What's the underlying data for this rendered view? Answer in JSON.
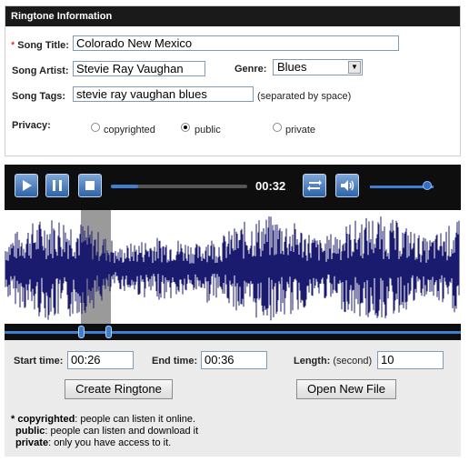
{
  "info": {
    "header": "Ringtone Information",
    "required_mark": "*",
    "song_title_label": "Song Title:",
    "song_title_value": "Colorado New Mexico",
    "song_artist_label": "Song Artist:",
    "song_artist_value": "Stevie Ray Vaughan",
    "genre_label": "Genre:",
    "genre_value": "Blues",
    "song_tags_label": "Song Tags:",
    "song_tags_value": "stevie ray vaughan blues",
    "song_tags_hint": "(separated by space)",
    "privacy_label": "Privacy:",
    "privacy_options": [
      "copyrighted",
      "public",
      "private"
    ],
    "privacy_selected": "public"
  },
  "player": {
    "time": "00:32",
    "progress_fraction": 0.2,
    "volume_fraction": 0.85,
    "icons": [
      "play-icon",
      "pause-icon",
      "stop-icon",
      "repeat-icon",
      "volume-icon"
    ]
  },
  "selection": {
    "start_label": "Start time:",
    "start_value": "00:26",
    "end_label": "End time:",
    "end_value": "00:36",
    "length_label": "Length:",
    "length_unit": "(second)",
    "length_value": "10"
  },
  "buttons": {
    "create": "Create Ringtone",
    "open": "Open New File"
  },
  "legend": {
    "copyrighted_term": "* copyrighted",
    "copyrighted_desc": ": people can listen it online.",
    "public_term": "public",
    "public_desc": ": people can listen and download it",
    "private_term": "private",
    "private_desc": ": only you have access to it."
  },
  "colors": {
    "accent": "#3d7fd1",
    "waveform": "#1a1a6e",
    "selection": "#9a9a9a"
  }
}
